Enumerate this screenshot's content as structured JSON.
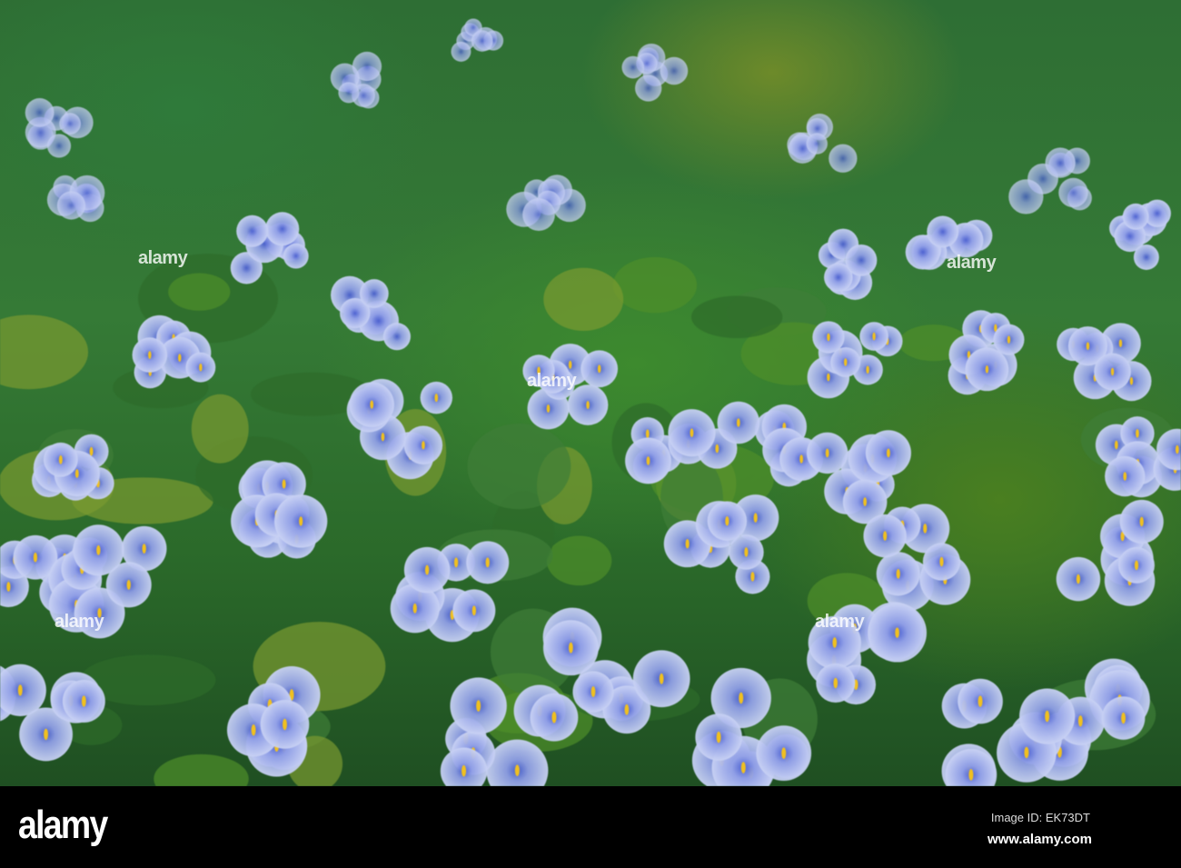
{
  "photo": {
    "subject": "water hyacinth flowers",
    "colors": {
      "petal": "#c9d2f4",
      "petal_center": "#4a5fd0",
      "spot": "#f0c020",
      "leaf": "#357a36"
    }
  },
  "watermark": {
    "text": "alamy"
  },
  "footer": {
    "logo": "alamy",
    "image_id": "Image ID: EK73DT",
    "website": "www.alamy.com"
  }
}
